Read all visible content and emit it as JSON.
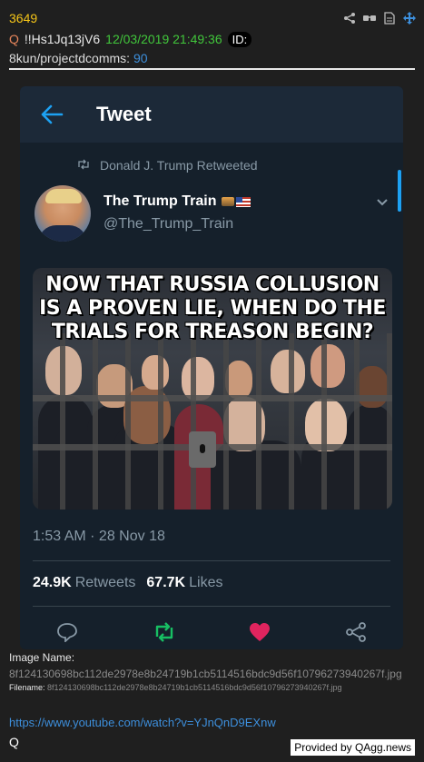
{
  "post": {
    "number": "3649",
    "trip_prefix": "Q",
    "tripcode": "!!Hs1Jq13jV6",
    "date": "12/03/2019 21:49:36",
    "id_label": "ID:",
    "board": "8kun/projectdcomms:",
    "board_number": "90"
  },
  "header_icons": [
    "share-icon",
    "glasses-icon",
    "document-icon",
    "move-icon"
  ],
  "tweet": {
    "title": "Tweet",
    "retweeted_by": "Donald J. Trump Retweeted",
    "account_name": "The Trump Train",
    "account_handle": "@The_Trump_Train",
    "meme_text": "NOW THAT RUSSIA COLLUSION IS A PROVEN LIE, WHEN DO THE TRIALS FOR TREASON BEGIN?",
    "time": "1:53 AM · 28 Nov 18",
    "retweets_count": "24.9K",
    "retweets_label": "Retweets",
    "likes_count": "67.7K",
    "likes_label": "Likes",
    "actions": [
      "reply-icon",
      "retweet-icon",
      "like-icon",
      "share-icon"
    ],
    "colors": {
      "background": "#15202b",
      "accent": "#1da1f2",
      "retweet": "#17bf63",
      "like": "#e0245e"
    }
  },
  "image_info": {
    "name_label": "Image Name:",
    "name_value": "8f124130698bc112de2978e8b24719b1cb5114516bdc9d56f10796273940267f.jpg",
    "filename_label": "Filename:",
    "filename_value": "8f124130698bc112de2978e8b24719b1cb5114516bdc9d56f10796273940267f.jpg"
  },
  "link": "https://www.youtube.com/watch?v=YJnQnD9EXnw",
  "signature": "Q",
  "provided_by": "Provided by QAgg.news"
}
